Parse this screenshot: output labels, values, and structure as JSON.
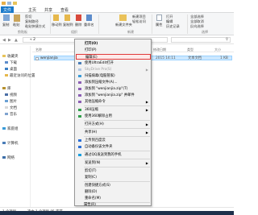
{
  "window": {
    "title": ""
  },
  "ribbon_tabs": [
    "文件",
    "主页",
    "共享",
    "查看"
  ],
  "ribbon": {
    "copy": "复制",
    "paste": "粘贴",
    "cut": "剪切",
    "copy_path": "复制路径",
    "paste_shortcut": "粘贴快捷方式",
    "clipboard": "剪贴板",
    "move_to": "移动到",
    "copy_to": "复制到",
    "delete": "删除",
    "rename": "重命名",
    "organize": "组织",
    "new_folder": "新建文件夹",
    "new_item": "新建项目",
    "easy_access": "轻松访问",
    "new": "新建",
    "properties": "属性",
    "open": "打开",
    "edit": "编辑",
    "history": "历史记录",
    "select_all": "全部选择",
    "select_none": "全部取消",
    "invert_selection": "反向选择",
    "select": "选择"
  },
  "address": {
    "path": "« 2",
    "search_placeholder": ""
  },
  "nav_pane": [
    {
      "label": "收藏夹",
      "icon": "star-icon"
    },
    {
      "label": "下载",
      "icon": "download-folder-icon"
    },
    {
      "label": "桌面",
      "icon": "desktop-icon"
    },
    {
      "label": "最近访问的位置",
      "icon": "recent-icon"
    },
    {
      "label": "库",
      "icon": "library-icon"
    },
    {
      "label": "视频",
      "icon": "video-icon"
    },
    {
      "label": "图片",
      "icon": "picture-icon"
    },
    {
      "label": "文档",
      "icon": "document-icon"
    },
    {
      "label": "音乐",
      "icon": "music-icon"
    },
    {
      "label": "家庭组",
      "icon": "homegroup-icon"
    },
    {
      "label": "计算机",
      "icon": "computer-icon"
    },
    {
      "label": "网络",
      "icon": "network-icon"
    }
  ],
  "columns": [
    "名称",
    "修改日期",
    "类型",
    "大小"
  ],
  "file_row": {
    "name": "wenjianjia",
    "date": "2015 14:11",
    "type": "文本文档",
    "size": "1 KB"
  },
  "context_menu": [
    {
      "label": "打开(O)",
      "bold": true
    },
    {
      "label": "打印(P)"
    },
    {
      "label": "编辑(E)",
      "highlighted": true
    },
    {
      "label": "使用UltraEdit打开"
    },
    {
      "label": "SkyDrive Pro(S)",
      "disabled": true,
      "submenu": true
    },
    {
      "label": "扫描病毒(电脑管家)"
    },
    {
      "label": "添加到压缩文件(A)..."
    },
    {
      "label": "添加到 \"wenjianjia.zip\"(T)"
    },
    {
      "label": "添加到 \"wenjianjia.zip\" 并邮件"
    },
    {
      "label": "其他压缩命令",
      "submenu": true
    },
    {
      "label": "360压缩",
      "submenu": true
    },
    {
      "label": "使用360解除占用"
    },
    {
      "label": "打开方式(H)",
      "submenu": true
    },
    {
      "label": "共享(H)",
      "submenu": true
    },
    {
      "label": "上传到百度云"
    },
    {
      "label": "自动备份该文件夹"
    },
    {
      "label": "通过QQ发送到我的手机"
    },
    {
      "label": "发送到(N)",
      "submenu": true
    },
    {
      "label": "剪切(T)"
    },
    {
      "label": "复制(C)"
    },
    {
      "label": "创建快捷方式(S)"
    },
    {
      "label": "删除(D)"
    },
    {
      "label": "重命名(M)"
    },
    {
      "label": "属性(R)"
    }
  ],
  "status": {
    "count": "1 个项目",
    "selected": "选中 1 个项目  85 字节"
  }
}
